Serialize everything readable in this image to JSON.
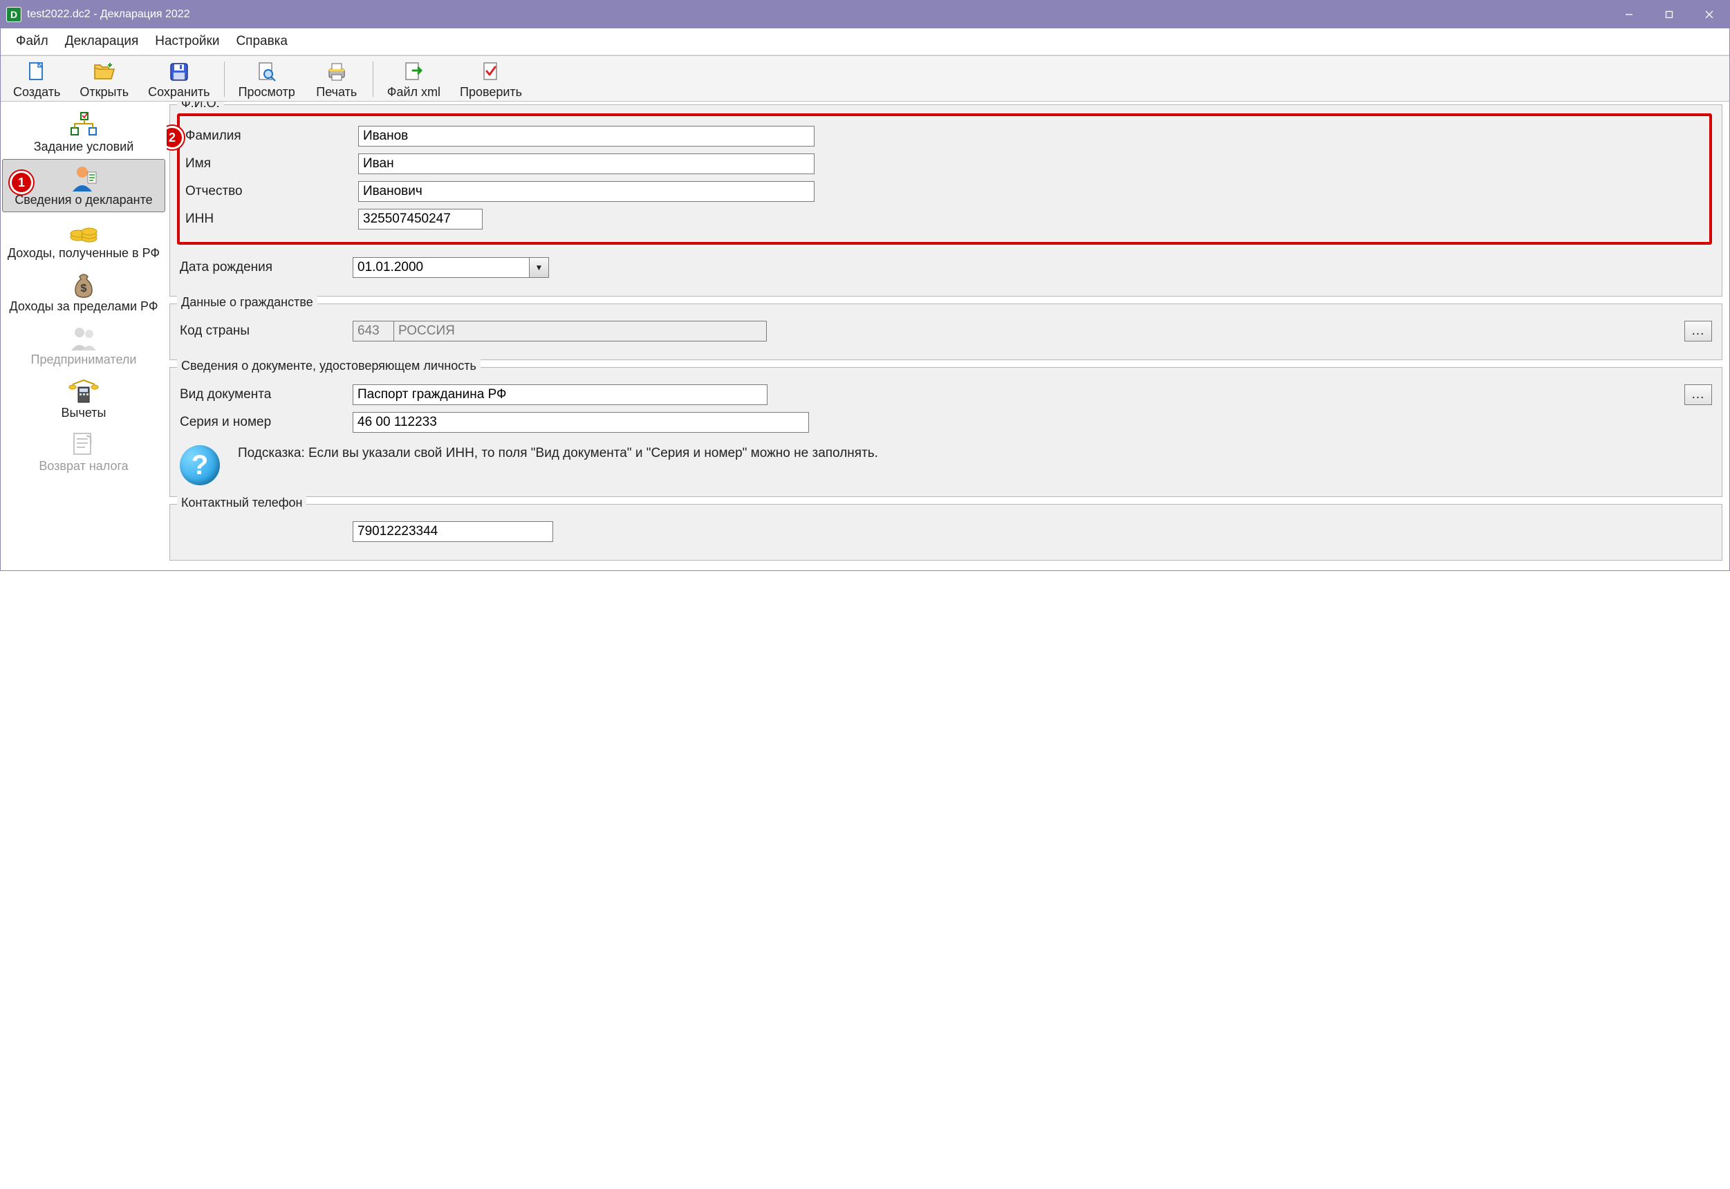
{
  "window": {
    "title": "test2022.dc2 - Декларация 2022"
  },
  "menu": {
    "file": "Файл",
    "declaration": "Декларация",
    "settings": "Настройки",
    "help": "Справка"
  },
  "toolbar": {
    "create": "Создать",
    "open": "Открыть",
    "save": "Сохранить",
    "preview": "Просмотр",
    "print": "Печать",
    "file_xml": "Файл xml",
    "check": "Проверить"
  },
  "sidebar": {
    "conditions": "Задание условий",
    "declarant": "Сведения о декларанте",
    "income_rf": "Доходы, полученные в РФ",
    "income_abroad": "Доходы за пределами РФ",
    "entrepreneurs": "Предприниматели",
    "deductions": "Вычеты",
    "tax_return": "Возврат налога"
  },
  "annotations": {
    "badge1": "1",
    "badge2": "2"
  },
  "fio": {
    "legend": "Ф.И.О.",
    "surname_label": "Фамилия",
    "surname": "Иванов",
    "name_label": "Имя",
    "name": "Иван",
    "patronymic_label": "Отчество",
    "patronymic": "Иванович",
    "inn_label": "ИНН",
    "inn": "325507450247",
    "dob_label": "Дата рождения",
    "dob": "01.01.2000"
  },
  "citizenship": {
    "legend": "Данные о гражданстве",
    "country_code_label": "Код страны",
    "country_code": "643",
    "country_name": "РОССИЯ",
    "browse": "..."
  },
  "identity": {
    "legend": "Сведения о документе, удостоверяющем личность",
    "doc_type_label": "Вид документа",
    "doc_type": "Паспорт гражданина РФ",
    "series_label": "Серия и номер",
    "series": "46 00 112233",
    "browse": "...",
    "hint": "Подсказка: Если вы указали свой ИНН, то поля \"Вид документа\" и \"Серия и номер\" можно не заполнять."
  },
  "contact": {
    "legend": "Контактный телефон",
    "phone": "79012223344"
  }
}
